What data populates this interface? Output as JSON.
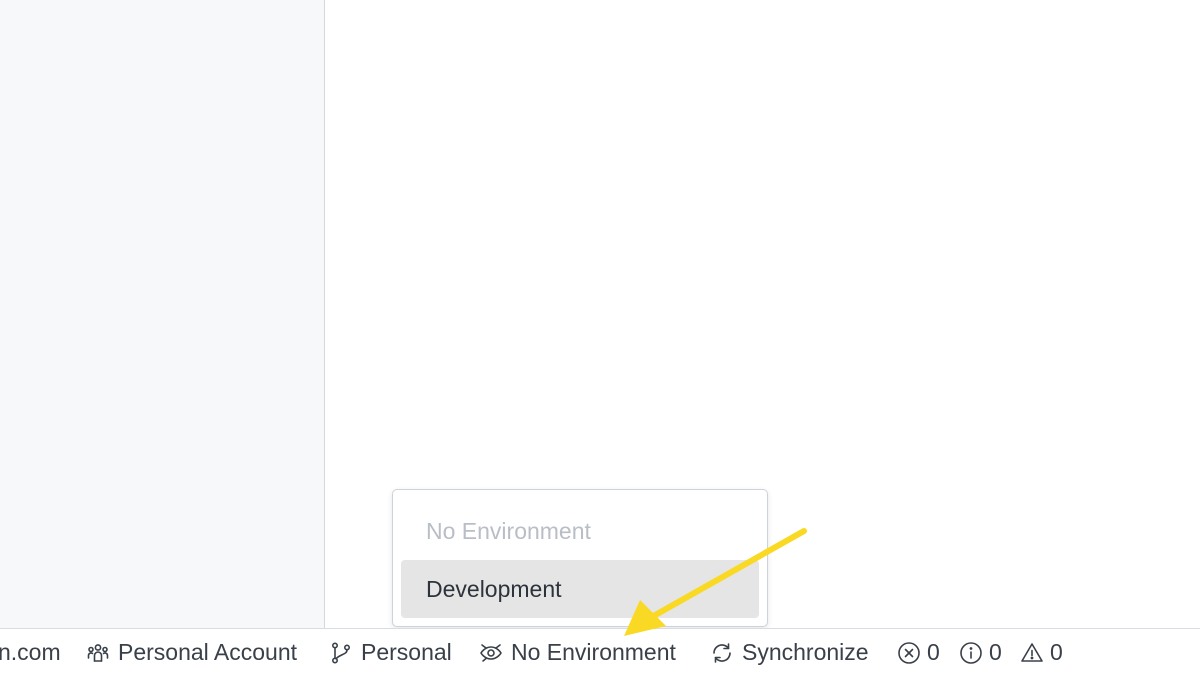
{
  "statusbar": {
    "account_email_fragment": "n.com",
    "account_label": "Personal Account",
    "workspace_label": "Personal",
    "environment_label": "No Environment",
    "sync_label": "Synchronize",
    "errors_count": "0",
    "info_count": "0",
    "warnings_count": "0"
  },
  "environment_dropdown": {
    "options": [
      {
        "label": "No Environment",
        "state": "disabled"
      },
      {
        "label": "Development",
        "state": "highlighted"
      }
    ]
  },
  "annotation": {
    "arrow_color": "#f9d923"
  },
  "icons": {
    "account": "users-icon",
    "workspace": "git-branch-icon",
    "environment": "environment-eye-icon",
    "sync": "refresh-icon",
    "errors": "error-circle-icon",
    "info": "info-circle-icon",
    "warnings": "warning-triangle-icon"
  }
}
